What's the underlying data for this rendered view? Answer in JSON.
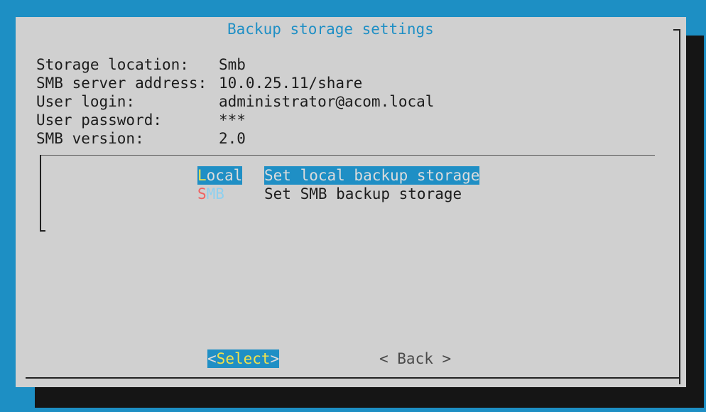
{
  "dialog": {
    "title": "Backup storage settings",
    "info": [
      {
        "label": "Storage location:",
        "value": "Smb"
      },
      {
        "label": "SMB server address:",
        "value": "10.0.25.11/share"
      },
      {
        "label": "User login:",
        "value": "administrator@acom.local"
      },
      {
        "label": "User password:",
        "value": "***"
      },
      {
        "label": "SMB version:",
        "value": "2.0"
      }
    ],
    "menu": [
      {
        "tag_hotkey": "L",
        "tag_rest": "ocal",
        "description": "Set local backup storage",
        "selected": true
      },
      {
        "tag_hotkey": "S",
        "tag_rest": "MB",
        "description": "Set SMB backup storage",
        "selected": false
      }
    ],
    "buttons": {
      "select": {
        "open": "<",
        "hotkey": "S",
        "rest": "elect",
        "close": ">"
      },
      "back": "< Back >"
    }
  },
  "colors": {
    "background": "#1d8fc4",
    "dialog": "#d0d0d0",
    "highlight": "#1f8fc5",
    "hotkey_selected": "#f0e24c",
    "hotkey_unselected": "#f06060"
  }
}
